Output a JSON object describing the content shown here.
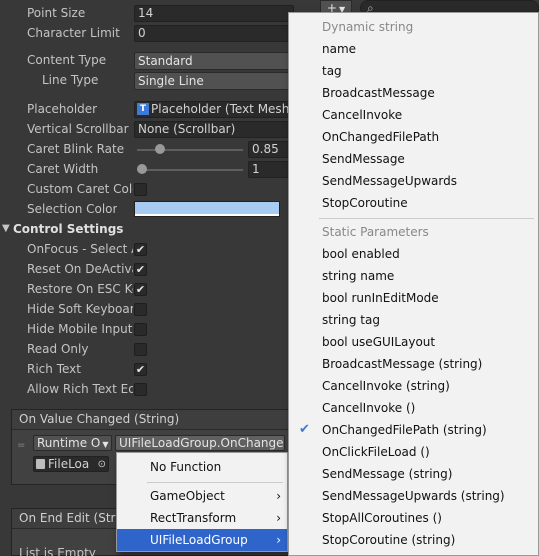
{
  "inspector": {
    "point_size": {
      "label": "Point Size",
      "value": "14"
    },
    "character_limit": {
      "label": "Character Limit",
      "value": "0"
    },
    "content_type": {
      "label": "Content Type",
      "value": "Standard"
    },
    "line_type": {
      "label": "Line Type",
      "value": "Single Line"
    },
    "placeholder": {
      "label": "Placeholder",
      "value": "Placeholder (Text Mesh"
    },
    "vertical_scrollbar": {
      "label": "Vertical Scrollbar",
      "value": "None (Scrollbar)"
    },
    "caret_blink_rate": {
      "label": "Caret Blink Rate",
      "value": "0.85",
      "fraction": 0.17
    },
    "caret_width": {
      "label": "Caret Width",
      "value": "1",
      "fraction": 0.0
    },
    "custom_caret_color": {
      "label": "Custom Caret Colo",
      "checked": false
    },
    "selection_color": {
      "label": "Selection Color",
      "color": "#a8cbf2"
    },
    "control_settings": {
      "title": "Control Settings",
      "toggles": [
        {
          "label": "OnFocus - Select A",
          "checked": true
        },
        {
          "label": "Reset On DeActiva",
          "checked": true
        },
        {
          "label": "Restore On ESC Ke",
          "checked": true
        },
        {
          "label": "Hide Soft Keyboar",
          "checked": false
        },
        {
          "label": "Hide Mobile Input",
          "checked": false
        },
        {
          "label": "Read Only",
          "checked": false
        },
        {
          "label": "Rich Text",
          "checked": true
        },
        {
          "label": "Allow Rich Text Ed",
          "checked": false
        }
      ]
    },
    "on_value_changed": {
      "title": "On Value Changed (String)",
      "runtime": "Runtime O",
      "function": "UIFileLoadGroup.OnChange",
      "object": "FileLoa"
    },
    "on_end_edit": {
      "title": "On End Edit (Strin",
      "list_empty": "List is Empty"
    },
    "search_glyph": "⌕",
    "add_button": "+"
  },
  "component_menu": {
    "items": [
      {
        "label": "No Function",
        "chevron": false
      },
      {
        "label": "GameObject",
        "chevron": true
      },
      {
        "label": "RectTransform",
        "chevron": true
      },
      {
        "label": "UIFileLoadGroup",
        "chevron": true,
        "selected": true
      }
    ]
  },
  "method_menu": {
    "dynamic_header": "Dynamic string",
    "dynamic": [
      "name",
      "tag",
      "BroadcastMessage",
      "CancelInvoke",
      "OnChangedFilePath",
      "SendMessage",
      "SendMessageUpwards",
      "StopCoroutine"
    ],
    "static_header": "Static Parameters",
    "static": [
      {
        "label": "bool enabled"
      },
      {
        "label": "string name"
      },
      {
        "label": "bool runInEditMode"
      },
      {
        "label": "string tag"
      },
      {
        "label": "bool useGUILayout"
      },
      {
        "label": "BroadcastMessage (string)"
      },
      {
        "label": "CancelInvoke (string)"
      },
      {
        "label": "CancelInvoke ()"
      },
      {
        "label": "OnChangedFilePath (string)",
        "checked": true
      },
      {
        "label": "OnClickFileLoad ()"
      },
      {
        "label": "SendMessage (string)"
      },
      {
        "label": "SendMessageUpwards (string)"
      },
      {
        "label": "StopAllCoroutines ()"
      },
      {
        "label": "StopCoroutine (string)"
      }
    ]
  },
  "colors": {
    "accent": "#2f65ca",
    "menu_bg": "#f2f2f2",
    "panel_bg": "#383838",
    "check": "#3a7bd5"
  }
}
